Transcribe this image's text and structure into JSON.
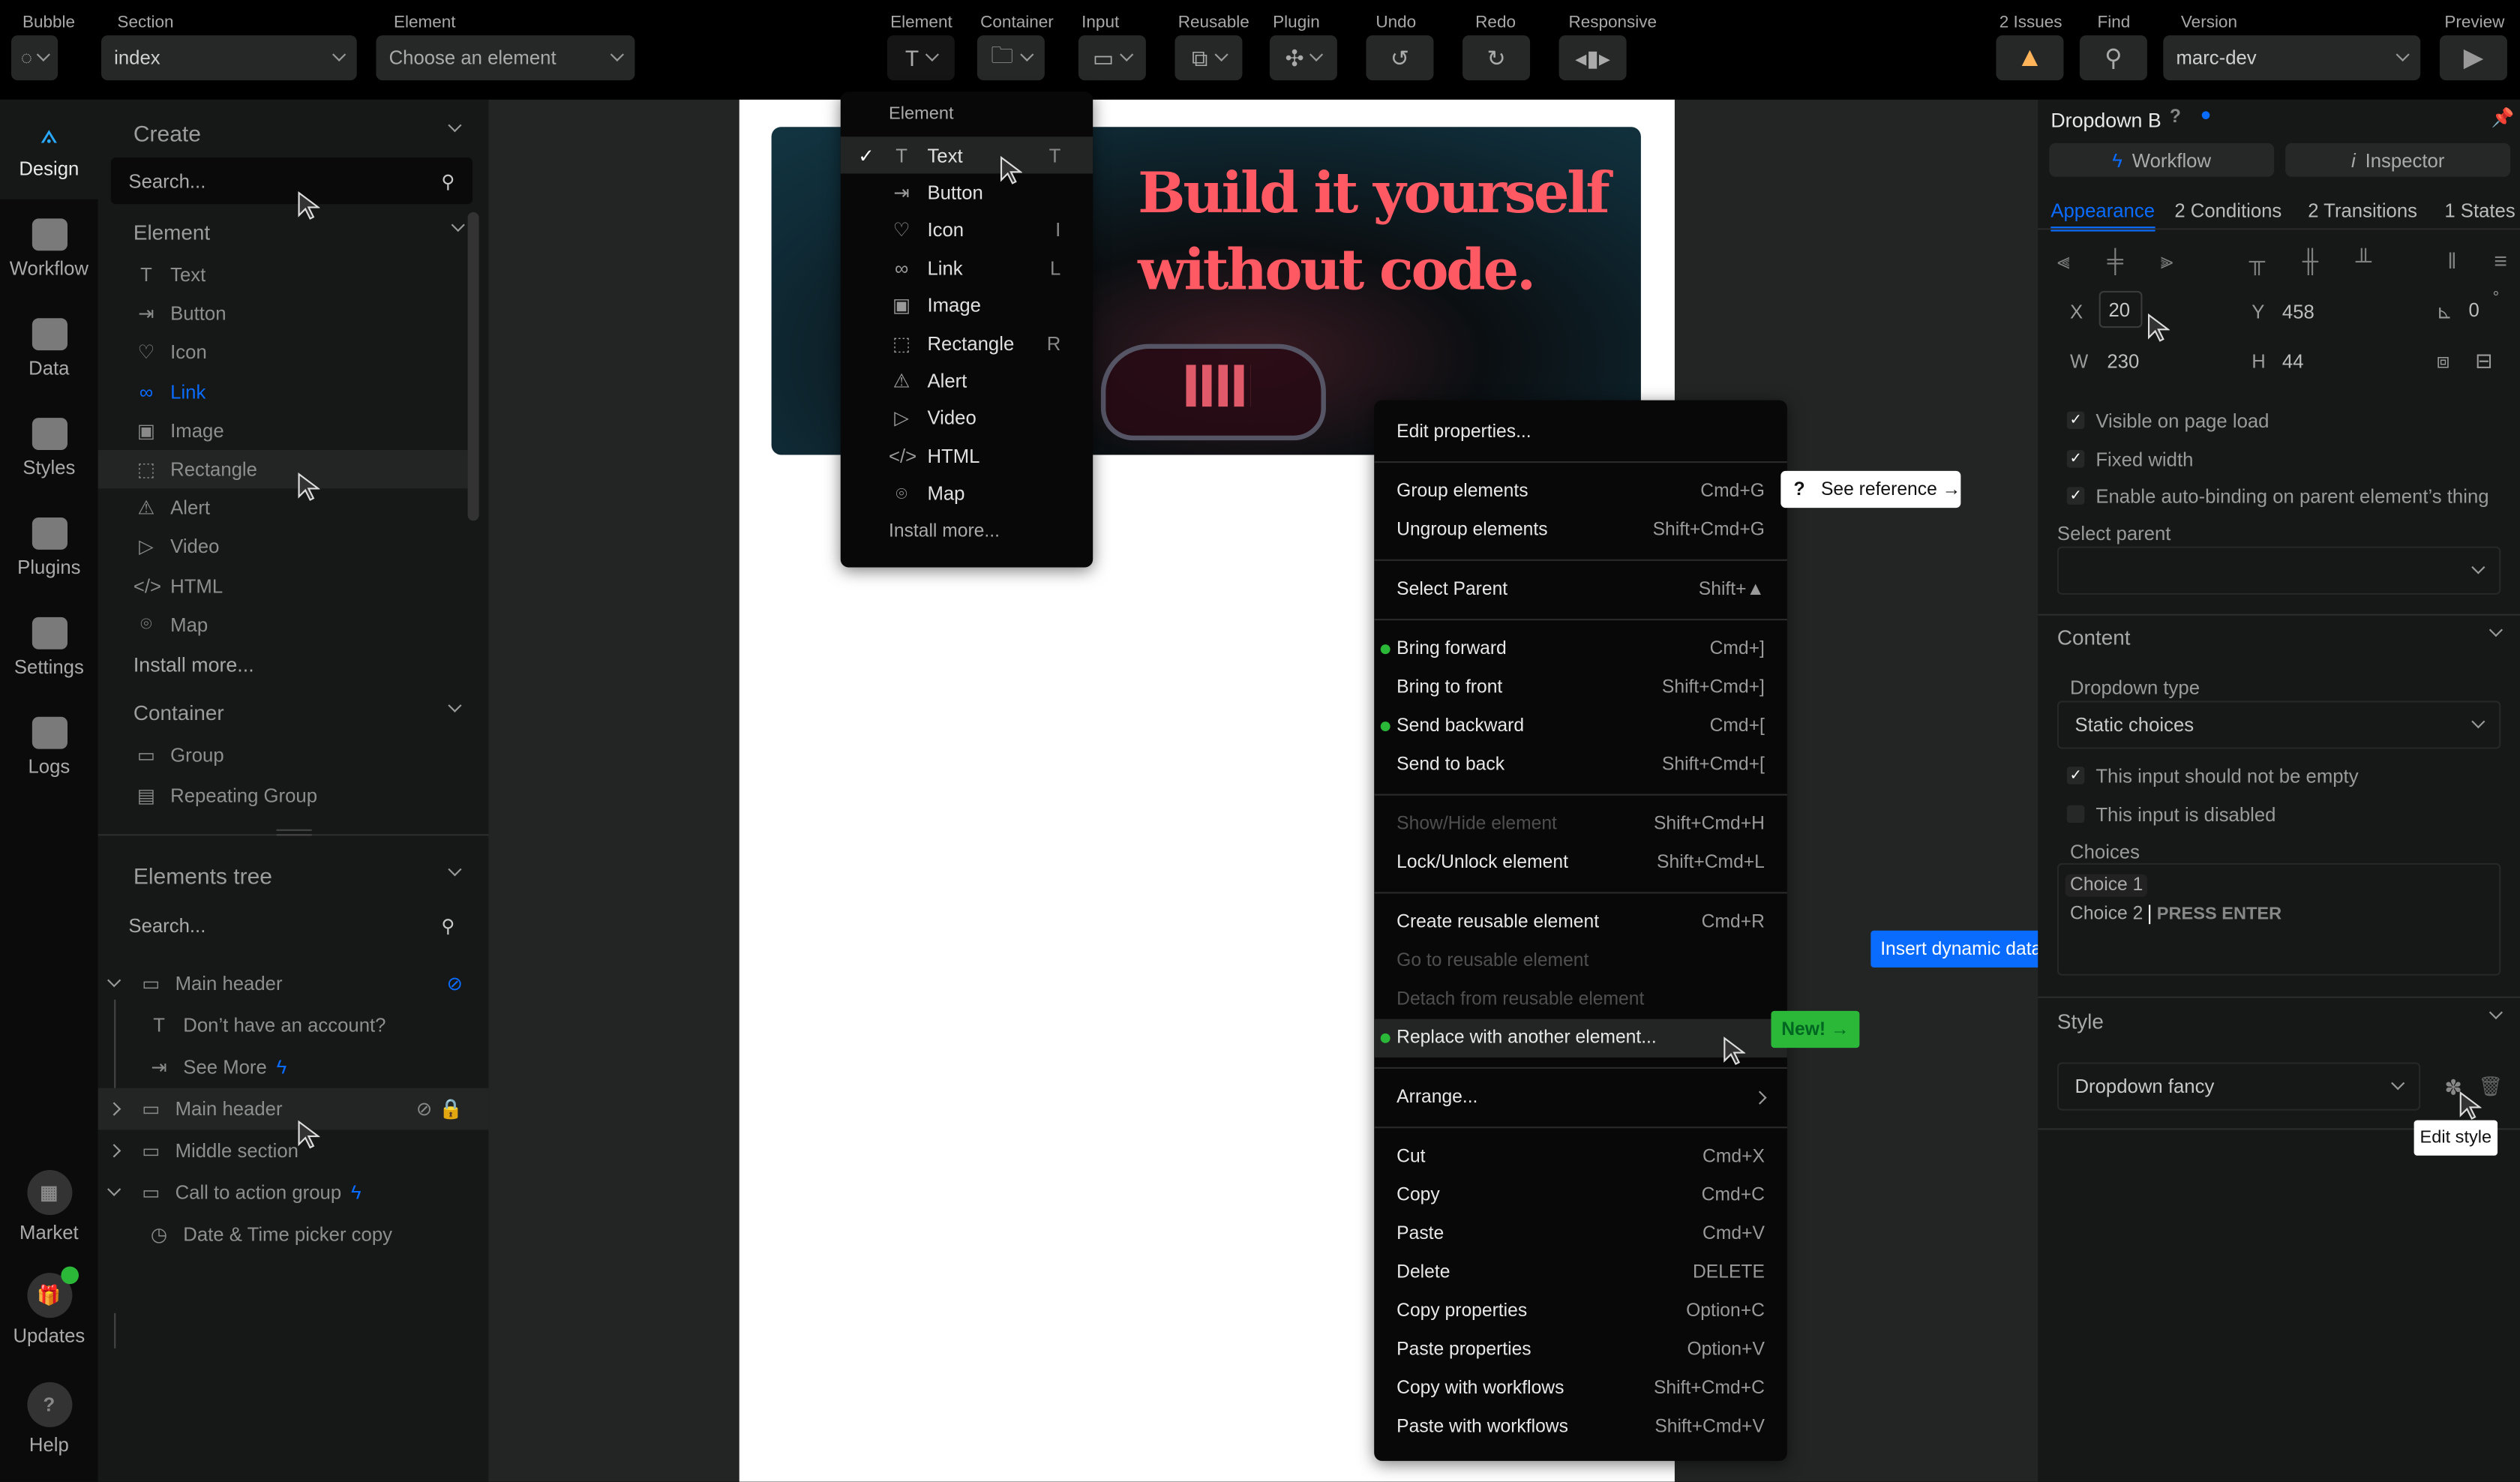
{
  "colors": {
    "accent": "#0a6cff",
    "success": "#2bb839",
    "warning": "#ffb45a",
    "hero_text": "#ff5a63"
  },
  "topbar": {
    "bubble_label": "Bubble",
    "section_label": "Section",
    "section_value": "index",
    "element_label": "Element",
    "element_placeholder": "Choose an element",
    "tools": [
      {
        "label": "Element",
        "icon": "text-icon"
      },
      {
        "label": "Container",
        "icon": "folder-icon"
      },
      {
        "label": "Input",
        "icon": "input-icon"
      },
      {
        "label": "Reusable",
        "icon": "reusable-icon"
      },
      {
        "label": "Plugin",
        "icon": "plugin-icon"
      },
      {
        "label": "Undo",
        "icon": "undo-icon"
      },
      {
        "label": "Redo",
        "icon": "redo-icon"
      },
      {
        "label": "Responsive",
        "icon": "responsive-icon"
      }
    ],
    "issues_label": "2 Issues",
    "find_label": "Find",
    "version_label": "Version",
    "version_value": "marc-dev",
    "preview_label": "Preview"
  },
  "rail": {
    "items": [
      {
        "label": "Design",
        "active": true
      },
      {
        "label": "Workflow"
      },
      {
        "label": "Data"
      },
      {
        "label": "Styles"
      },
      {
        "label": "Plugins"
      },
      {
        "label": "Settings"
      },
      {
        "label": "Logs"
      }
    ],
    "bottom": [
      {
        "label": "Market"
      },
      {
        "label": "Updates",
        "badge": true
      },
      {
        "label": "Help"
      }
    ]
  },
  "create": {
    "title": "Create",
    "search_placeholder": "Search...",
    "element_header": "Element",
    "elements": [
      {
        "label": "Text",
        "icon": "T"
      },
      {
        "label": "Button",
        "icon": "⇥"
      },
      {
        "label": "Icon",
        "icon": "♡"
      },
      {
        "label": "Link",
        "icon": "∞",
        "active": true
      },
      {
        "label": "Image",
        "icon": "▣"
      },
      {
        "label": "Rectangle",
        "icon": "⬚",
        "hover": true
      },
      {
        "label": "Alert",
        "icon": "⚠"
      },
      {
        "label": "Video",
        "icon": "▷"
      },
      {
        "label": "HTML",
        "icon": "</>"
      },
      {
        "label": "Map",
        "icon": "⌾"
      }
    ],
    "install_more": "Install more...",
    "container_header": "Container",
    "containers": [
      {
        "label": "Group",
        "icon": "▭"
      },
      {
        "label": "Repeating Group",
        "icon": "▤"
      }
    ]
  },
  "tree": {
    "title": "Elements tree",
    "search_placeholder": "Search...",
    "rows": [
      {
        "label": "Main header",
        "level": 0,
        "expand": "down",
        "icon": "▭",
        "hidden_blue": true
      },
      {
        "label": "Don’t have an account?",
        "level": 1,
        "icon": "T"
      },
      {
        "label": "See More",
        "level": 1,
        "icon": "⇥",
        "workflow": true
      },
      {
        "label": "Main header",
        "level": 0,
        "expand": "right",
        "icon": "▭",
        "hidden": true,
        "locked": true,
        "hover": true
      },
      {
        "label": "Middle section",
        "level": 0,
        "expand": "right",
        "icon": "▭"
      },
      {
        "label": "Call to action group",
        "level": 0,
        "expand": "down",
        "icon": "▭",
        "workflow": true
      },
      {
        "label": "Date & Time picker copy",
        "level": 1,
        "icon": "◷"
      }
    ]
  },
  "hero": {
    "line1": "Build it yourself",
    "line2": "without code."
  },
  "element_menu": {
    "header": "Element",
    "items": [
      {
        "label": "Text",
        "icon": "T",
        "key": "T",
        "checked": true
      },
      {
        "label": "Button",
        "icon": "⇥",
        "key": ""
      },
      {
        "label": "Icon",
        "icon": "♡",
        "key": "I"
      },
      {
        "label": "Link",
        "icon": "∞",
        "key": "L"
      },
      {
        "label": "Image",
        "icon": "▣",
        "key": ""
      },
      {
        "label": "Rectangle",
        "icon": "⬚",
        "key": "R"
      },
      {
        "label": "Alert",
        "icon": "⚠",
        "key": ""
      },
      {
        "label": "Video",
        "icon": "▷",
        "key": ""
      },
      {
        "label": "HTML",
        "icon": "</>",
        "key": ""
      },
      {
        "label": "Map",
        "icon": "⌾",
        "key": ""
      }
    ],
    "install_more": "Install more..."
  },
  "context_menu": {
    "groups": [
      [
        {
          "label": "Edit properties..."
        }
      ],
      [
        {
          "label": "Group elements",
          "shortcut": "Cmd+G"
        },
        {
          "label": "Ungroup elements",
          "shortcut": "Shift+Cmd+G"
        }
      ],
      [
        {
          "label": "Select Parent",
          "shortcut": "Shift+▲"
        }
      ],
      [
        {
          "label": "Bring forward",
          "shortcut": "Cmd+]",
          "dot": true
        },
        {
          "label": "Bring to front",
          "shortcut": "Shift+Cmd+]"
        },
        {
          "label": "Send backward",
          "shortcut": "Cmd+[",
          "dot": true
        },
        {
          "label": "Send to back",
          "shortcut": "Shift+Cmd+["
        }
      ],
      [
        {
          "label": "Show/Hide element",
          "shortcut": "Shift+Cmd+H",
          "disabled": true
        },
        {
          "label": "Lock/Unlock element",
          "shortcut": "Shift+Cmd+L"
        }
      ],
      [
        {
          "label": "Create reusable element",
          "shortcut": "Cmd+R"
        },
        {
          "label": "Go to reusable element",
          "disabled": true
        },
        {
          "label": "Detach from reusable element",
          "disabled": true
        },
        {
          "label": "Replace with another element...",
          "dot": true,
          "highlight": true
        }
      ],
      [
        {
          "label": "Arrange...",
          "submenu": true
        }
      ],
      [
        {
          "label": "Cut",
          "shortcut": "Cmd+X"
        },
        {
          "label": "Copy",
          "shortcut": "Cmd+C"
        },
        {
          "label": "Paste",
          "shortcut": "Cmd+V"
        },
        {
          "label": "Delete",
          "shortcut": "DELETE"
        },
        {
          "label": "Copy properties",
          "shortcut": "Option+C"
        },
        {
          "label": "Paste properties",
          "shortcut": "Option+V"
        },
        {
          "label": "Copy with workflows",
          "shortcut": "Shift+Cmd+C"
        },
        {
          "label": "Paste with workflows",
          "shortcut": "Shift+Cmd+V"
        }
      ]
    ]
  },
  "see_reference": {
    "icon": "?",
    "label": "See reference →"
  },
  "new_badge": "New! →",
  "insert_dynamic": "Insert dynamic data",
  "props": {
    "title": "Dropdown B",
    "workflow_btn": "Workflow",
    "inspector_btn": "Inspector",
    "tabs": [
      {
        "label": "Appearance",
        "active": true
      },
      {
        "label": "2 Conditions"
      },
      {
        "label": "2 Transitions"
      },
      {
        "label": "1 States"
      }
    ],
    "x_label": "X",
    "x": "20",
    "y_label": "Y",
    "y": "458",
    "rot": "0",
    "rot_unit": "°",
    "w_label": "W",
    "w": "230",
    "h_label": "H",
    "h": "44",
    "checks": [
      {
        "label": "Visible on page load",
        "checked": true
      },
      {
        "label": "Fixed width",
        "checked": true
      },
      {
        "label": "Enable auto-binding on parent element’s thing",
        "checked": true
      }
    ],
    "select_parent": "Select parent",
    "content": {
      "title": "Content",
      "dropdown_type_label": "Dropdown type",
      "dropdown_type": "Static choices",
      "checks": [
        {
          "label": "This input should not be empty",
          "checked": true
        },
        {
          "label": "This input is disabled",
          "checked": false
        }
      ],
      "choices_label": "Choices",
      "choice1": "Choice 1",
      "choice2": "Choice 2",
      "press_enter": "PRESS ENTER"
    },
    "style": {
      "title": "Style",
      "value": "Dropdown fancy",
      "tooltip": "Edit style"
    }
  }
}
